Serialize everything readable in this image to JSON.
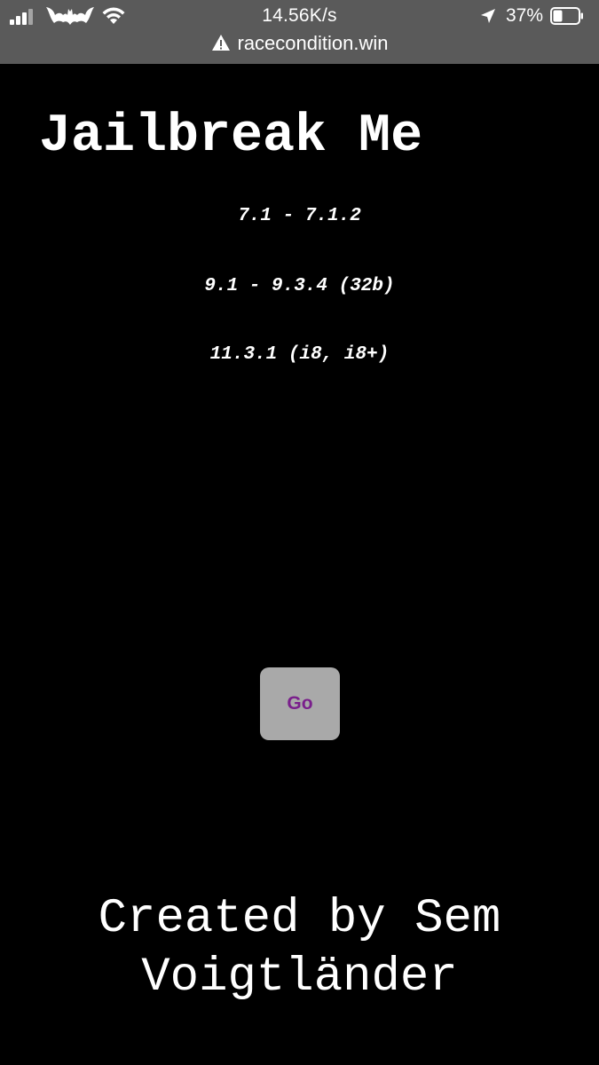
{
  "status_bar": {
    "network_speed": "14.56K/s",
    "battery_percent": "37%",
    "battery_level": 0.37,
    "icons": [
      "signal-icon",
      "bat-logo-icon",
      "wifi-icon",
      "location-arrow-icon",
      "battery-icon"
    ]
  },
  "address_bar": {
    "url": "racecondition.win",
    "security_icon": "warning-icon"
  },
  "page": {
    "title": "Jailbreak Me",
    "versions": [
      "7.1 - 7.1.2",
      "9.1 - 9.3.4 (32b)",
      "11.3.1 (i8, i8+)"
    ],
    "go_label": "Go",
    "footer_line1": "Created by Sem",
    "footer_line2": "Voigtländer"
  },
  "colors": {
    "background": "#000000",
    "topbar": "#5a5a5a",
    "button_bg": "#a9a9a9",
    "button_text": "#7a1f8c",
    "text": "#ffffff"
  }
}
